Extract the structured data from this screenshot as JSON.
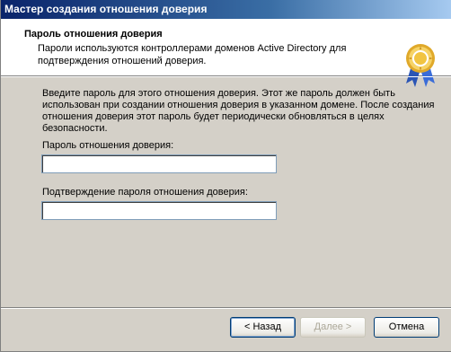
{
  "window": {
    "title": "Мастер создания отношения доверия"
  },
  "header": {
    "title": "Пароль отношения доверия",
    "subtitle": "Пароли используются контроллерами доменов Active Directory для подтверждения отношений доверия.",
    "icon": "certificate-medal-icon"
  },
  "main": {
    "description": "Введите пароль для этого отношения доверия. Этот же пароль должен быть использован при создании отношения доверия в указанном домене. После создания отношения доверия этот пароль будет периодически обновляться в целях безопасности.",
    "password_label": "Пароль отношения доверия:",
    "password_value": "",
    "confirm_label": "Подтверждение пароля отношения доверия:",
    "confirm_value": ""
  },
  "buttons": {
    "back": "< Назад",
    "next": "Далее >",
    "cancel": "Отмена"
  },
  "colors": {
    "titlebar": "#0a246a",
    "dialog_bg": "#d4d0c8",
    "header_bg": "#ffffff"
  }
}
